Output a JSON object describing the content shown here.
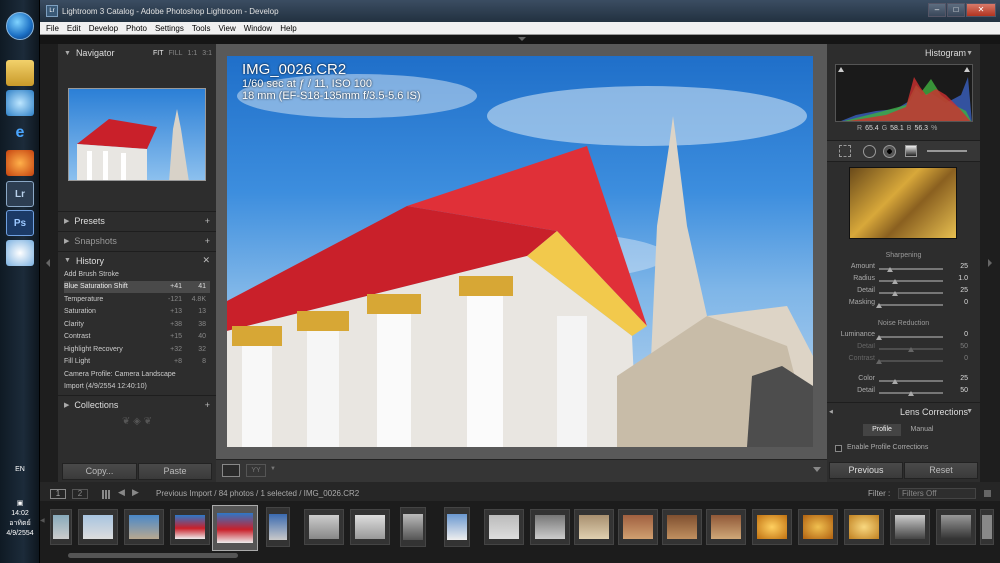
{
  "taskbar": {
    "icons": [
      "explorer-icon",
      "network-icon",
      "internet-explorer-icon",
      "firefox-icon",
      "lightroom-icon",
      "photoshop-icon",
      "paint-icon"
    ],
    "lr_label": "Lr",
    "ps_label": "Ps",
    "lang": "EN",
    "time": "14:02",
    "day": "อาทิตย์",
    "date": "4/9/2554"
  },
  "window": {
    "title": "Lightroom 3 Catalog - Adobe Photoshop Lightroom - Develop",
    "menu": [
      "File",
      "Edit",
      "Develop",
      "Photo",
      "Settings",
      "Tools",
      "View",
      "Window",
      "Help"
    ]
  },
  "left": {
    "navigator": {
      "title": "Navigator",
      "zoom_fit": "FIT",
      "zoom_fill": "FILL",
      "zoom_1": "1:1",
      "zoom_3": "3:1"
    },
    "presets": {
      "title": "Presets"
    },
    "snapshots": {
      "title": "Snapshots"
    },
    "history": {
      "title": "History",
      "items": [
        {
          "label": "Add Brush Stroke",
          "a": "",
          "b": ""
        },
        {
          "label": "Blue Saturation Shift",
          "a": "+41",
          "b": "41"
        },
        {
          "label": "Temperature",
          "a": "-121",
          "b": "4.8K"
        },
        {
          "label": "Saturation",
          "a": "+13",
          "b": "13"
        },
        {
          "label": "Clarity",
          "a": "+38",
          "b": "38"
        },
        {
          "label": "Contrast",
          "a": "+15",
          "b": "40"
        },
        {
          "label": "Highlight Recovery",
          "a": "+32",
          "b": "32"
        },
        {
          "label": "Fill Light",
          "a": "+8",
          "b": "8"
        },
        {
          "label": "Camera Profile: Camera Landscape",
          "a": "",
          "b": ""
        },
        {
          "label": "Import (4/9/2554 12:40:10)",
          "a": "",
          "b": ""
        }
      ]
    },
    "collections": {
      "title": "Collections"
    },
    "copy_label": "Copy...",
    "paste_label": "Paste"
  },
  "photo": {
    "filename": "IMG_0026.CR2",
    "exposure": "1/60 sec at ƒ / 11, ISO 100",
    "lens": "18 mm (EF-S18-135mm f/3.5-5.6 IS)"
  },
  "right": {
    "histogram": {
      "title": "Histogram",
      "r_label": "R",
      "r_value": "65.4",
      "g_label": "G",
      "g_value": "58.1",
      "b_label": "B",
      "b_value": "56.3",
      "unit": "%"
    },
    "sharpening": {
      "title": "Sharpening",
      "rows": [
        {
          "label": "Amount",
          "value": "25",
          "level": 0.17
        },
        {
          "label": "Radius",
          "value": "1.0",
          "level": 0.25
        },
        {
          "label": "Detail",
          "value": "25",
          "level": 0.25
        },
        {
          "label": "Masking",
          "value": "0",
          "level": 0.0
        }
      ]
    },
    "noise_reduction": {
      "title": "Noise Reduction",
      "rows": [
        {
          "label": "Luminance",
          "value": "0",
          "level": 0.0
        },
        {
          "label": "Detail",
          "value": "50",
          "level": 0.5
        },
        {
          "label": "Contrast",
          "value": "0",
          "level": 0.0
        },
        {
          "label": "Color",
          "value": "25",
          "level": 0.25
        },
        {
          "label": "Detail",
          "value": "50",
          "level": 0.5
        }
      ]
    },
    "lens_corrections": {
      "title": "Lens Corrections",
      "tab_profile": "Profile",
      "tab_manual": "Manual",
      "enable_label": "Enable Profile Corrections"
    },
    "previous_label": "Previous",
    "reset_label": "Reset"
  },
  "filmbar": {
    "page1": "1",
    "page2": "2",
    "path": "Previous Import / 84 photos / 1 selected / IMG_0026.CR2",
    "filter_label": "Filter :",
    "filter_value": "Filters Off"
  },
  "colors": {
    "panel": "#2d2d2d",
    "center": "#595959",
    "accent_red": "#c9202a",
    "sky": "#3d8ede"
  }
}
